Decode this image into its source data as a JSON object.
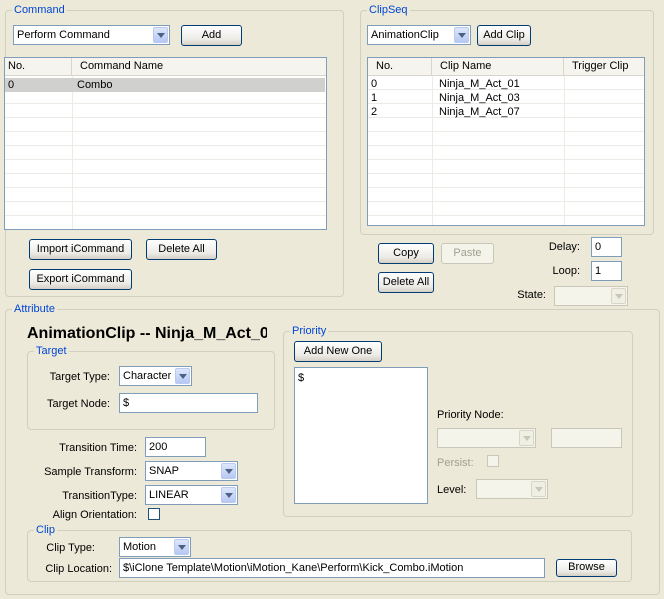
{
  "command": {
    "legend": "Command",
    "perform_select": "Perform Command",
    "add_label": "Add",
    "table_headers": [
      "No.",
      "Command Name"
    ],
    "rows": [
      {
        "no": "0",
        "name": "Combo"
      }
    ],
    "import_label": "Import iCommand",
    "delete_all_label": "Delete All",
    "export_label": "Export iCommand"
  },
  "clipseq": {
    "legend": "ClipSeq",
    "type_select": "AnimationClip",
    "add_clip_label": "Add Clip",
    "table_headers": [
      "No.",
      "Clip Name",
      "Trigger Clip"
    ],
    "rows": [
      {
        "no": "0",
        "name": "Ninja_M_Act_01",
        "trigger": ""
      },
      {
        "no": "1",
        "name": "Ninja_M_Act_03",
        "trigger": ""
      },
      {
        "no": "2",
        "name": "Ninja_M_Act_07",
        "trigger": ""
      }
    ],
    "copy_label": "Copy",
    "paste_label": "Paste",
    "delete_all_label": "Delete All",
    "delay_label": "Delay:",
    "delay_value": "0",
    "loop_label": "Loop:",
    "loop_value": "1",
    "state_label": "State:",
    "state_value": ""
  },
  "attribute": {
    "legend": "Attribute",
    "title": "AnimationClip --  Ninja_M_Act_0",
    "target": {
      "legend": "Target",
      "type_label": "Target Type:",
      "type_value": "Character",
      "node_label": "Target Node:",
      "node_value": "$"
    },
    "transition_time_label": "Transition Time:",
    "transition_time_value": "200",
    "sample_transform_label": "Sample Transform:",
    "sample_transform_value": "SNAP",
    "transition_type_label": "TransitionType:",
    "transition_type_value": "LINEAR",
    "align_orientation_label": "Align Orientation:",
    "align_orientation_checked": false,
    "priority": {
      "legend": "Priority",
      "add_new_label": "Add New One",
      "list_items": [
        "$"
      ],
      "node_label": "Priority Node:",
      "persist_label": "Persist:",
      "level_label": "Level:"
    },
    "clip": {
      "legend": "Clip",
      "type_label": "Clip Type:",
      "type_value": "Motion",
      "location_label": "Clip Location:",
      "location_value": "$\\iClone Template\\Motion\\iMotion_Kane\\Perform\\Kick_Combo.iMotion",
      "browse_label": "Browse"
    }
  },
  "colors": {
    "accent": "#0046d5",
    "background": "#ece9d8",
    "border": "#7f9db9"
  }
}
